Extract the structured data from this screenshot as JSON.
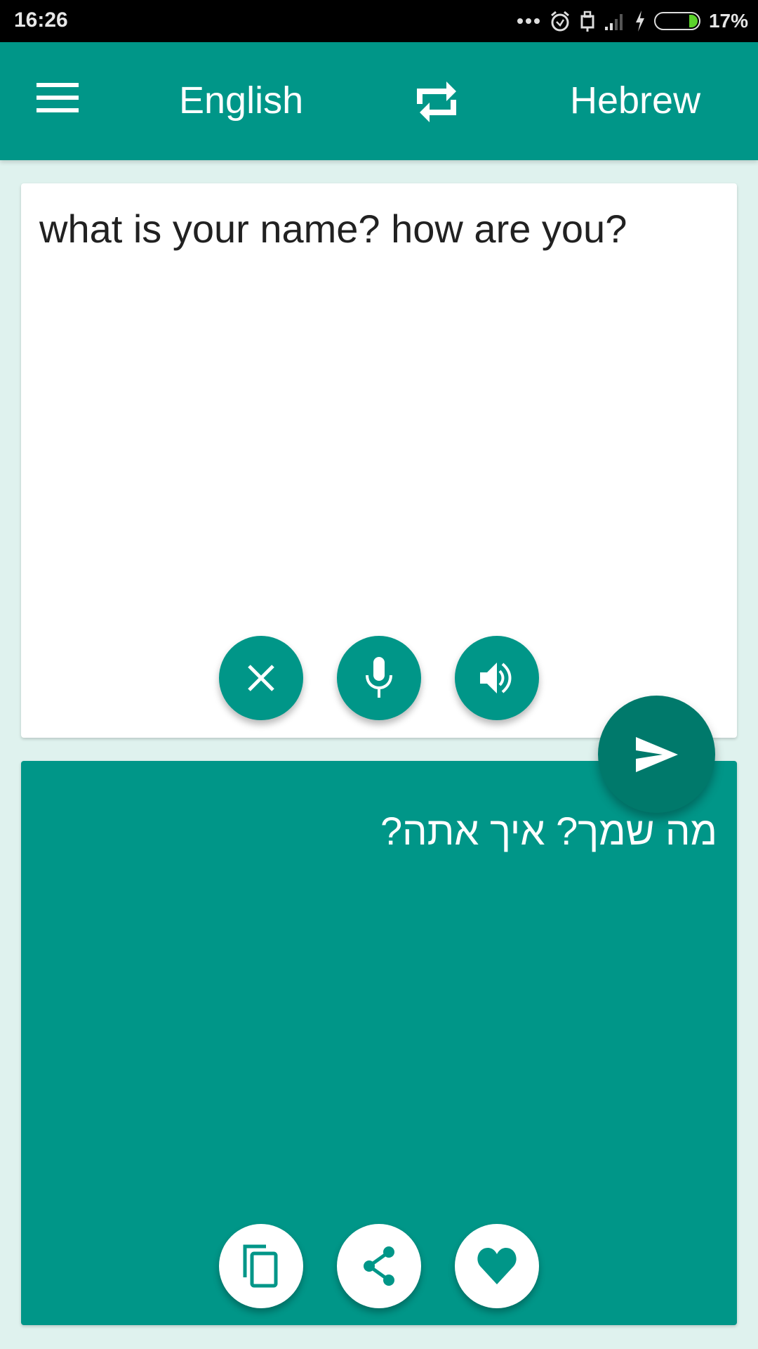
{
  "status_bar": {
    "time": "16:26",
    "icons": [
      "more-dots-icon",
      "alarm-icon",
      "usb-icon",
      "signal-icon",
      "charging-icon",
      "battery-icon"
    ],
    "battery_percent": "17%",
    "battery_color": "#5bd12b"
  },
  "toolbar": {
    "menu_icon": "hamburger-menu-icon",
    "source_language": "English",
    "swap_icon": "swap-languages-icon",
    "target_language": "Hebrew",
    "color": "#009688"
  },
  "input_panel": {
    "text": "what is your name? how are you?",
    "buttons": [
      {
        "name": "clear",
        "icon": "close-icon"
      },
      {
        "name": "microphone",
        "icon": "microphone-icon"
      },
      {
        "name": "speak",
        "icon": "speaker-icon"
      }
    ]
  },
  "translate_button": {
    "icon": "send-icon",
    "color": "#00796b"
  },
  "output_panel": {
    "text": "מה שמך? איך אתה?",
    "buttons": [
      {
        "name": "copy",
        "icon": "copy-icon"
      },
      {
        "name": "share",
        "icon": "share-icon"
      },
      {
        "name": "favorite",
        "icon": "heart-icon"
      }
    ]
  }
}
